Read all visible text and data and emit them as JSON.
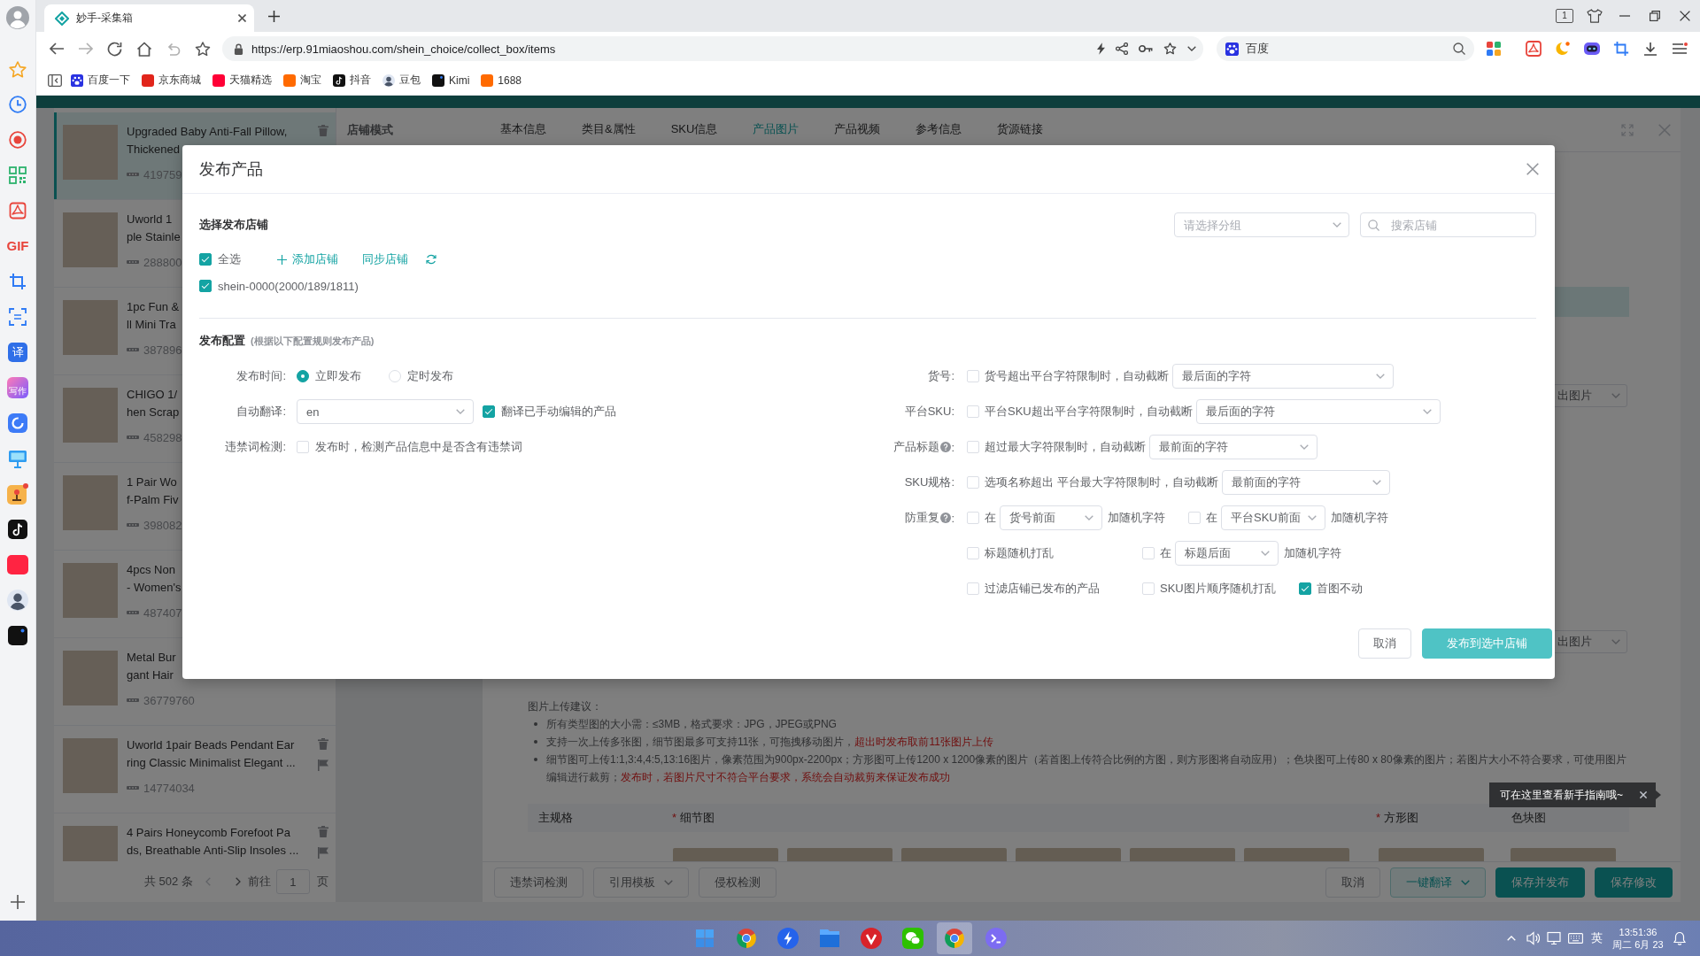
{
  "browser": {
    "tab": {
      "title": "妙手-采集箱"
    },
    "tab_counter": "1",
    "address": "https://erp.91miaoshou.com/shein_choice/collect_box/items",
    "search": {
      "engine": "百度"
    },
    "bookmarks": [
      {
        "label": "百度一下"
      },
      {
        "label": "京东商城"
      },
      {
        "label": "天猫精选"
      },
      {
        "label": "淘宝"
      },
      {
        "label": "抖音"
      },
      {
        "label": "豆包"
      },
      {
        "label": "Kimi"
      },
      {
        "label": "1688"
      }
    ]
  },
  "side_rail": {
    "gif_label": "GIF",
    "translate_label": "译",
    "writing_label": "写作"
  },
  "product_list": {
    "items": [
      {
        "title_lines": [
          "Upgraded Baby Anti-Fall Pillow,",
          "Thickened"
        ],
        "code": "419759",
        "selected": true
      },
      {
        "title_lines": [
          "Uworld 1",
          "ple Stainle"
        ],
        "code": "288800",
        "selected": false
      },
      {
        "title_lines": [
          "1pc Fun &",
          "ll Mini Tra"
        ],
        "code": "387896",
        "selected": false
      },
      {
        "title_lines": [
          "CHIGO 1/",
          "hen Scrap"
        ],
        "code": "458298",
        "selected": false
      },
      {
        "title_lines": [
          "1 Pair Wo",
          "f-Palm Fiv"
        ],
        "code": "398082",
        "selected": false
      },
      {
        "title_lines": [
          "4pcs Non",
          "- Women's"
        ],
        "code": "487407",
        "selected": false
      },
      {
        "title_lines": [
          "Metal Bur",
          "gant Hair"
        ],
        "code": "36779760",
        "selected": false
      },
      {
        "title_lines": [
          "Uworld 1pair Beads Pendant Ear",
          "ring Classic Minimalist Elegant ..."
        ],
        "code": "14774034",
        "selected": false
      },
      {
        "title_lines": [
          "4 Pairs Honeycomb Forefoot Pa",
          "ds, Breathable Anti-Slip Insoles ..."
        ],
        "selected": false
      }
    ],
    "pagination": {
      "total": "共 502 条",
      "goto": "前往",
      "page": "1",
      "unit": "页"
    }
  },
  "editor": {
    "store_mode": "店铺模式",
    "tabs": [
      {
        "label": "基本信息",
        "selected": false
      },
      {
        "label": "类目&属性",
        "selected": false
      },
      {
        "label": "SKU信息",
        "selected": false
      },
      {
        "label": "产品图片",
        "selected": true
      },
      {
        "label": "产品视频",
        "selected": false
      },
      {
        "label": "参考信息",
        "selected": false
      },
      {
        "label": "货源链接",
        "selected": false
      }
    ],
    "export_selects": [
      "出图片",
      "出图片"
    ],
    "upload_tips": {
      "title": "图片上传建议：",
      "items": [
        [
          {
            "text": "所有类型图的大小需：≤3MB，格式要求：JPG，JPEG或PNG",
            "kind": "plain"
          }
        ],
        [
          {
            "text": "支持一次上传多张图，细节图最多可支持11张，可拖拽移动图片，",
            "kind": "plain"
          },
          {
            "text": "超出时发布取前11张图片上传",
            "kind": "warning"
          }
        ],
        [
          {
            "text": "细节图可上传1:1,3:4,4:5,13:16图片，像素范围为900px-2200px；方形图可上传1200 x 1200像素的图片（若首图上传符合比例的方图，则方形图将自动应用）；色块图可上传80 x 80像素的图片；若图片大小不符合要求，可使用图片编辑进行裁剪；",
            "kind": "plain"
          },
          {
            "text": "发布时，若图片尺寸不符合平台要求，系统会自动裁剪来保证发布成功",
            "kind": "warning"
          }
        ]
      ]
    },
    "image_table": {
      "columns": [
        {
          "label": "主规格"
        },
        {
          "label": "细节图",
          "required_mark": "*"
        },
        {
          "label": "方形图",
          "required_mark": "*"
        },
        {
          "label": "色块图"
        }
      ]
    },
    "toolbar": {
      "left": [
        {
          "label": "违禁词检测",
          "kind": "default",
          "dropdown": false
        },
        {
          "label": "引用模板",
          "kind": "default",
          "dropdown": true
        },
        {
          "label": "侵权检测",
          "kind": "default",
          "dropdown": false
        }
      ],
      "right": [
        {
          "label": "取消",
          "kind": "default",
          "dropdown": false
        },
        {
          "label": "一键翻译",
          "kind": "outline",
          "dropdown": true
        },
        {
          "label": "保存并发布",
          "kind": "primary",
          "dropdown": false
        },
        {
          "label": "保存修改",
          "kind": "primary",
          "dropdown": false
        }
      ]
    }
  },
  "tooltip": {
    "text": "可在这里查看新手指南哦~"
  },
  "dialog": {
    "title": "发布产品",
    "store_section": {
      "title": "选择发布店铺",
      "group_select": {
        "placeholder": "请选择分组"
      },
      "store_search": {
        "placeholder": "搜索店铺"
      },
      "select_all": {
        "label": "全选",
        "checked": true
      },
      "add_store": "添加店铺",
      "sync_store": "同步店铺",
      "stores": [
        {
          "label": "shein-0000(2000/189/1811)",
          "checked": true
        }
      ]
    },
    "config_section": {
      "title": "发布配置",
      "note": "(根据以下配置规则发布产品)",
      "left_rows": [
        {
          "label": "发布时间:",
          "controls": [
            {
              "kind": "radio",
              "label": "立即发布",
              "selected": true
            },
            {
              "kind": "radio",
              "label": "定时发布",
              "selected": false
            }
          ]
        },
        {
          "label": "自动翻译:",
          "controls": [
            {
              "kind": "select",
              "value": "en"
            },
            {
              "kind": "checkbox",
              "label": "翻译已手动编辑的产品",
              "checked": true
            }
          ]
        },
        {
          "label": "违禁词检测:",
          "controls": [
            {
              "kind": "checkbox",
              "label": "发布时，检测产品信息中是否含有违禁词",
              "checked": false
            }
          ]
        }
      ],
      "right_rows": [
        {
          "label": "货号:",
          "help": false,
          "groups": [
            [
              {
                "kind": "checkbox",
                "label": "货号超出平台字符限制时，自动截断",
                "checked": false
              },
              {
                "kind": "select",
                "value": "最后面的字符"
              }
            ]
          ]
        },
        {
          "label": "平台SKU:",
          "help": false,
          "groups": [
            [
              {
                "kind": "checkbox",
                "label": "平台SKU超出平台字符限制时，自动截断",
                "checked": false
              },
              {
                "kind": "select",
                "value": "最后面的字符"
              }
            ]
          ]
        },
        {
          "label": "产品标题",
          "help": true,
          "label_end": ":",
          "groups": [
            [
              {
                "kind": "checkbox",
                "label": "超过最大字符限制时，自动截断",
                "checked": false
              },
              {
                "kind": "select",
                "value": "最前面的字符"
              }
            ]
          ]
        },
        {
          "label": "SKU规格:",
          "help": false,
          "groups": [
            [
              {
                "kind": "checkbox",
                "label": "选项名称超出 平台最大字符限制时，自动截断",
                "checked": false
              },
              {
                "kind": "select",
                "value": "最前面的字符"
              }
            ]
          ]
        },
        {
          "label": "防重复",
          "help": true,
          "label_end": ":",
          "groups": [
            [
              {
                "kind": "checkbox",
                "label": "在",
                "checked": false
              },
              {
                "kind": "select",
                "value": "货号前面"
              },
              {
                "kind": "text",
                "text": "加随机字符"
              }
            ],
            [
              {
                "kind": "checkbox",
                "label": "在",
                "checked": false
              },
              {
                "kind": "select",
                "value": "平台SKU前面"
              },
              {
                "kind": "text",
                "text": "加随机字符"
              }
            ]
          ]
        },
        {
          "help": false,
          "groups": [
            [
              {
                "kind": "checkbox",
                "label": "标题随机打乱",
                "checked": false
              }
            ],
            [
              {
                "kind": "checkbox",
                "label": "在",
                "checked": false
              },
              {
                "kind": "select",
                "value": "标题后面"
              },
              {
                "kind": "text",
                "text": "加随机字符"
              }
            ]
          ]
        },
        {
          "help": false,
          "groups": [
            [
              {
                "kind": "checkbox",
                "label": "过滤店铺已发布的产品",
                "checked": false
              }
            ],
            [
              {
                "kind": "checkbox",
                "label": "SKU图片顺序随机打乱",
                "checked": false
              }
            ],
            [
              {
                "kind": "checkbox",
                "label": "首图不动",
                "checked": true
              }
            ]
          ]
        }
      ]
    },
    "buttons": [
      {
        "label": "取消",
        "kind": "default"
      },
      {
        "label": "发布到选中店铺",
        "kind": "primary"
      }
    ]
  },
  "taskbar": {
    "apps": [
      {
        "selected": false
      },
      {
        "selected": false
      },
      {
        "selected": false
      },
      {
        "selected": false
      },
      {
        "selected": false
      },
      {
        "selected": true
      },
      {
        "selected": false
      }
    ],
    "input_method": "英",
    "time": "13:51:36",
    "date": "周二 6月 23"
  }
}
